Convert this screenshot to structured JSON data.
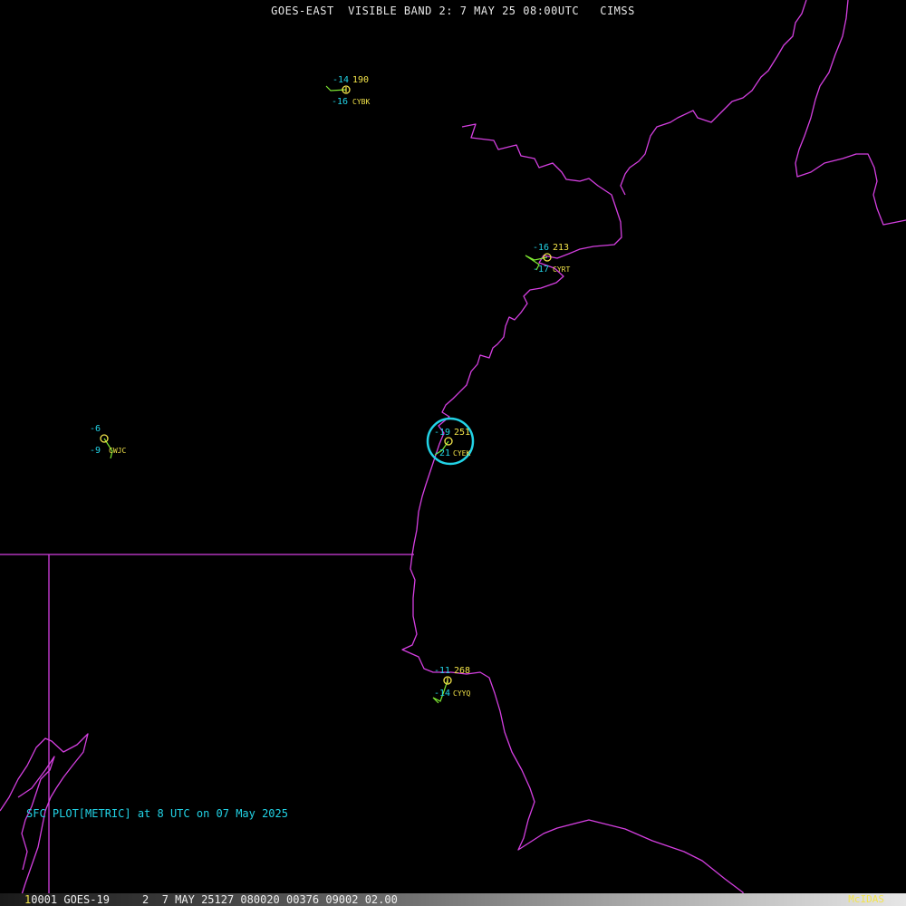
{
  "header": {
    "title": "GOES-EAST  VISIBLE BAND 2: 7 MAY 25 08:00UTC   CIMSS"
  },
  "legend": {
    "text": "SFC PLOT[METRIC] at 8 UTC on 07 May 2025"
  },
  "status_bar": {
    "frame": "1",
    "info": "0001 GOES-19     2  7 MAY 25127 080020 00376 09002 02.00",
    "brand": "McIDAS"
  },
  "colors": {
    "background": "#000000",
    "boundary": "#d43fe0",
    "temperature": "#22d3e6",
    "pressure": "#f3e44a",
    "wind_barb": "#7ee832",
    "station_circle": "#f3e44a",
    "highlight": "#22d3e6"
  },
  "stations": [
    {
      "id": "CYBK",
      "temp": "-14",
      "dew": "-16",
      "pressure": "190"
    },
    {
      "id": "CYRT",
      "temp": "-16",
      "dew": "-17",
      "pressure": "213"
    },
    {
      "id": "CWJC",
      "temp": "-6",
      "dew": "-9",
      "pressure": ""
    },
    {
      "id": "CYEK",
      "temp": "-19",
      "dew": "-21",
      "pressure": "251"
    },
    {
      "id": "CYYQ",
      "temp": "-11",
      "dew": "-14",
      "pressure": "268"
    }
  ]
}
